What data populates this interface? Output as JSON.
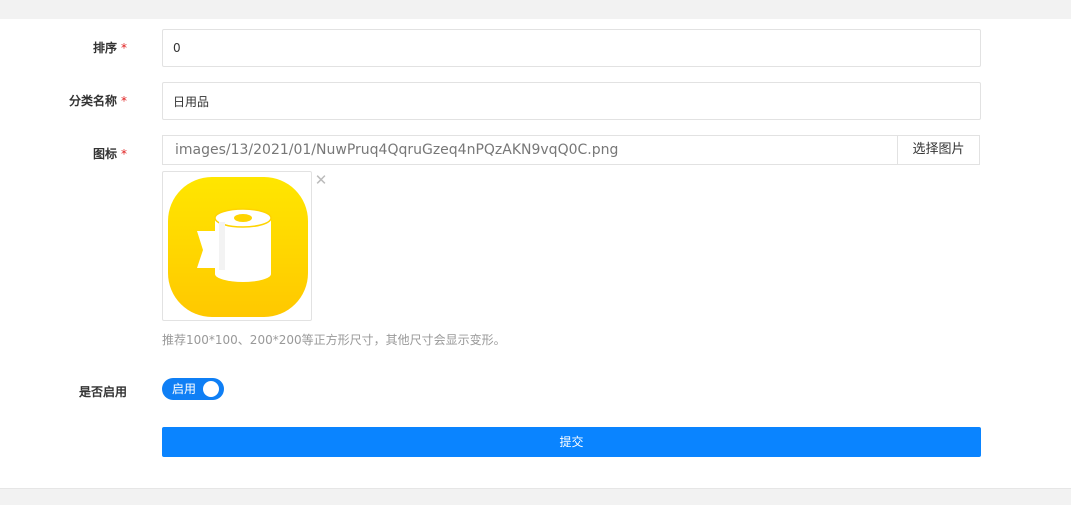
{
  "form": {
    "sort": {
      "label": "排序",
      "required_mark": "*",
      "value": "0"
    },
    "category_name": {
      "label": "分类名称",
      "required_mark": "*",
      "value": "日用品"
    },
    "icon": {
      "label": "图标",
      "required_mark": "*",
      "path": "images/13/2021/01/NuwPruq4QqruGzeq4nPQzAKN9vqQ0C.png",
      "choose_button": "选择图片",
      "remove_icon": "close-icon",
      "preview_icon": "toilet-paper-icon",
      "hint": "推荐100*100、200*200等正方形尺寸，其他尺寸会显示变形。"
    },
    "enabled": {
      "label": "是否启用",
      "toggle_text": "启用",
      "on": true
    },
    "submit_label": "提交"
  },
  "colors": {
    "accent": "#0a84ff",
    "required": "#e02020",
    "icon_yellow_top": "#ffe600",
    "icon_yellow_bottom": "#ffc800"
  }
}
